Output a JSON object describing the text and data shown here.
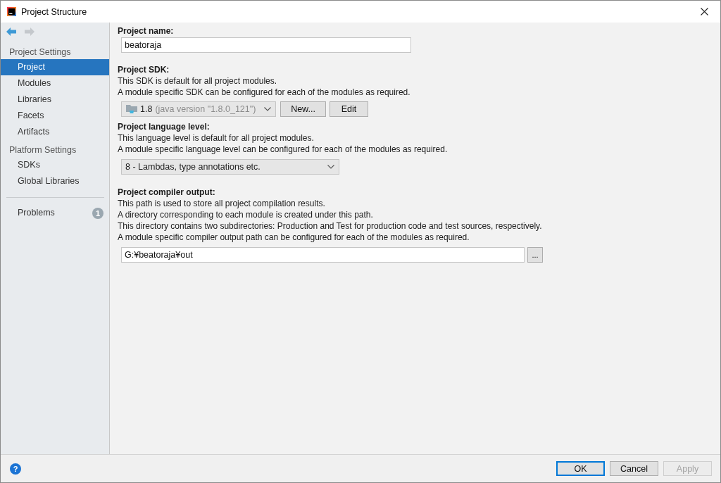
{
  "window": {
    "title": "Project Structure"
  },
  "navigation": [
    {
      "kind": "back",
      "disabled": false
    },
    {
      "kind": "forward",
      "disabled": true
    }
  ],
  "sidebar": {
    "sections": [
      {
        "title": "Project Settings",
        "items": [
          {
            "label": "Project",
            "selected": true
          },
          {
            "label": "Modules",
            "selected": false
          },
          {
            "label": "Libraries",
            "selected": false
          },
          {
            "label": "Facets",
            "selected": false
          },
          {
            "label": "Artifacts",
            "selected": false
          }
        ]
      },
      {
        "title": "Platform Settings",
        "items": [
          {
            "label": "SDKs",
            "selected": false
          },
          {
            "label": "Global Libraries",
            "selected": false
          }
        ]
      }
    ],
    "problems": {
      "label": "Problems",
      "count": "1",
      "selected": false
    }
  },
  "project_name": {
    "label": "Project name:",
    "value": "beatoraja"
  },
  "project_sdk": {
    "label": "Project SDK:",
    "description": [
      "This SDK is default for all project modules.",
      "A module specific SDK can be configured for each of the modules as required."
    ],
    "selection": {
      "version": "1.8",
      "detail": "(java version \"1.8.0_121\")"
    },
    "buttons": [
      "New...",
      "Edit"
    ]
  },
  "language_level": {
    "label": "Project language level:",
    "description": [
      "This language level is default for all project modules.",
      "A module specific language level can be configured for each of the modules as required."
    ],
    "selection": "8 - Lambdas, type annotations etc."
  },
  "compiler_output": {
    "label": "Project compiler output:",
    "description": [
      "This path is used to store all project compilation results.",
      "A directory corresponding to each module is created under this path.",
      "This directory contains two subdirectories: Production and Test for production code and test sources, respectively.",
      "A module specific compiler output path can be configured for each of the modules as required."
    ],
    "value": "G:¥beatoraja¥out",
    "browse_button": "..."
  },
  "footer": {
    "help_button": "?",
    "buttons": [
      {
        "label": "OK",
        "default": true,
        "disabled": false
      },
      {
        "label": "Cancel",
        "default": false,
        "disabled": false
      },
      {
        "label": "Apply",
        "default": false,
        "disabled": true
      }
    ]
  }
}
